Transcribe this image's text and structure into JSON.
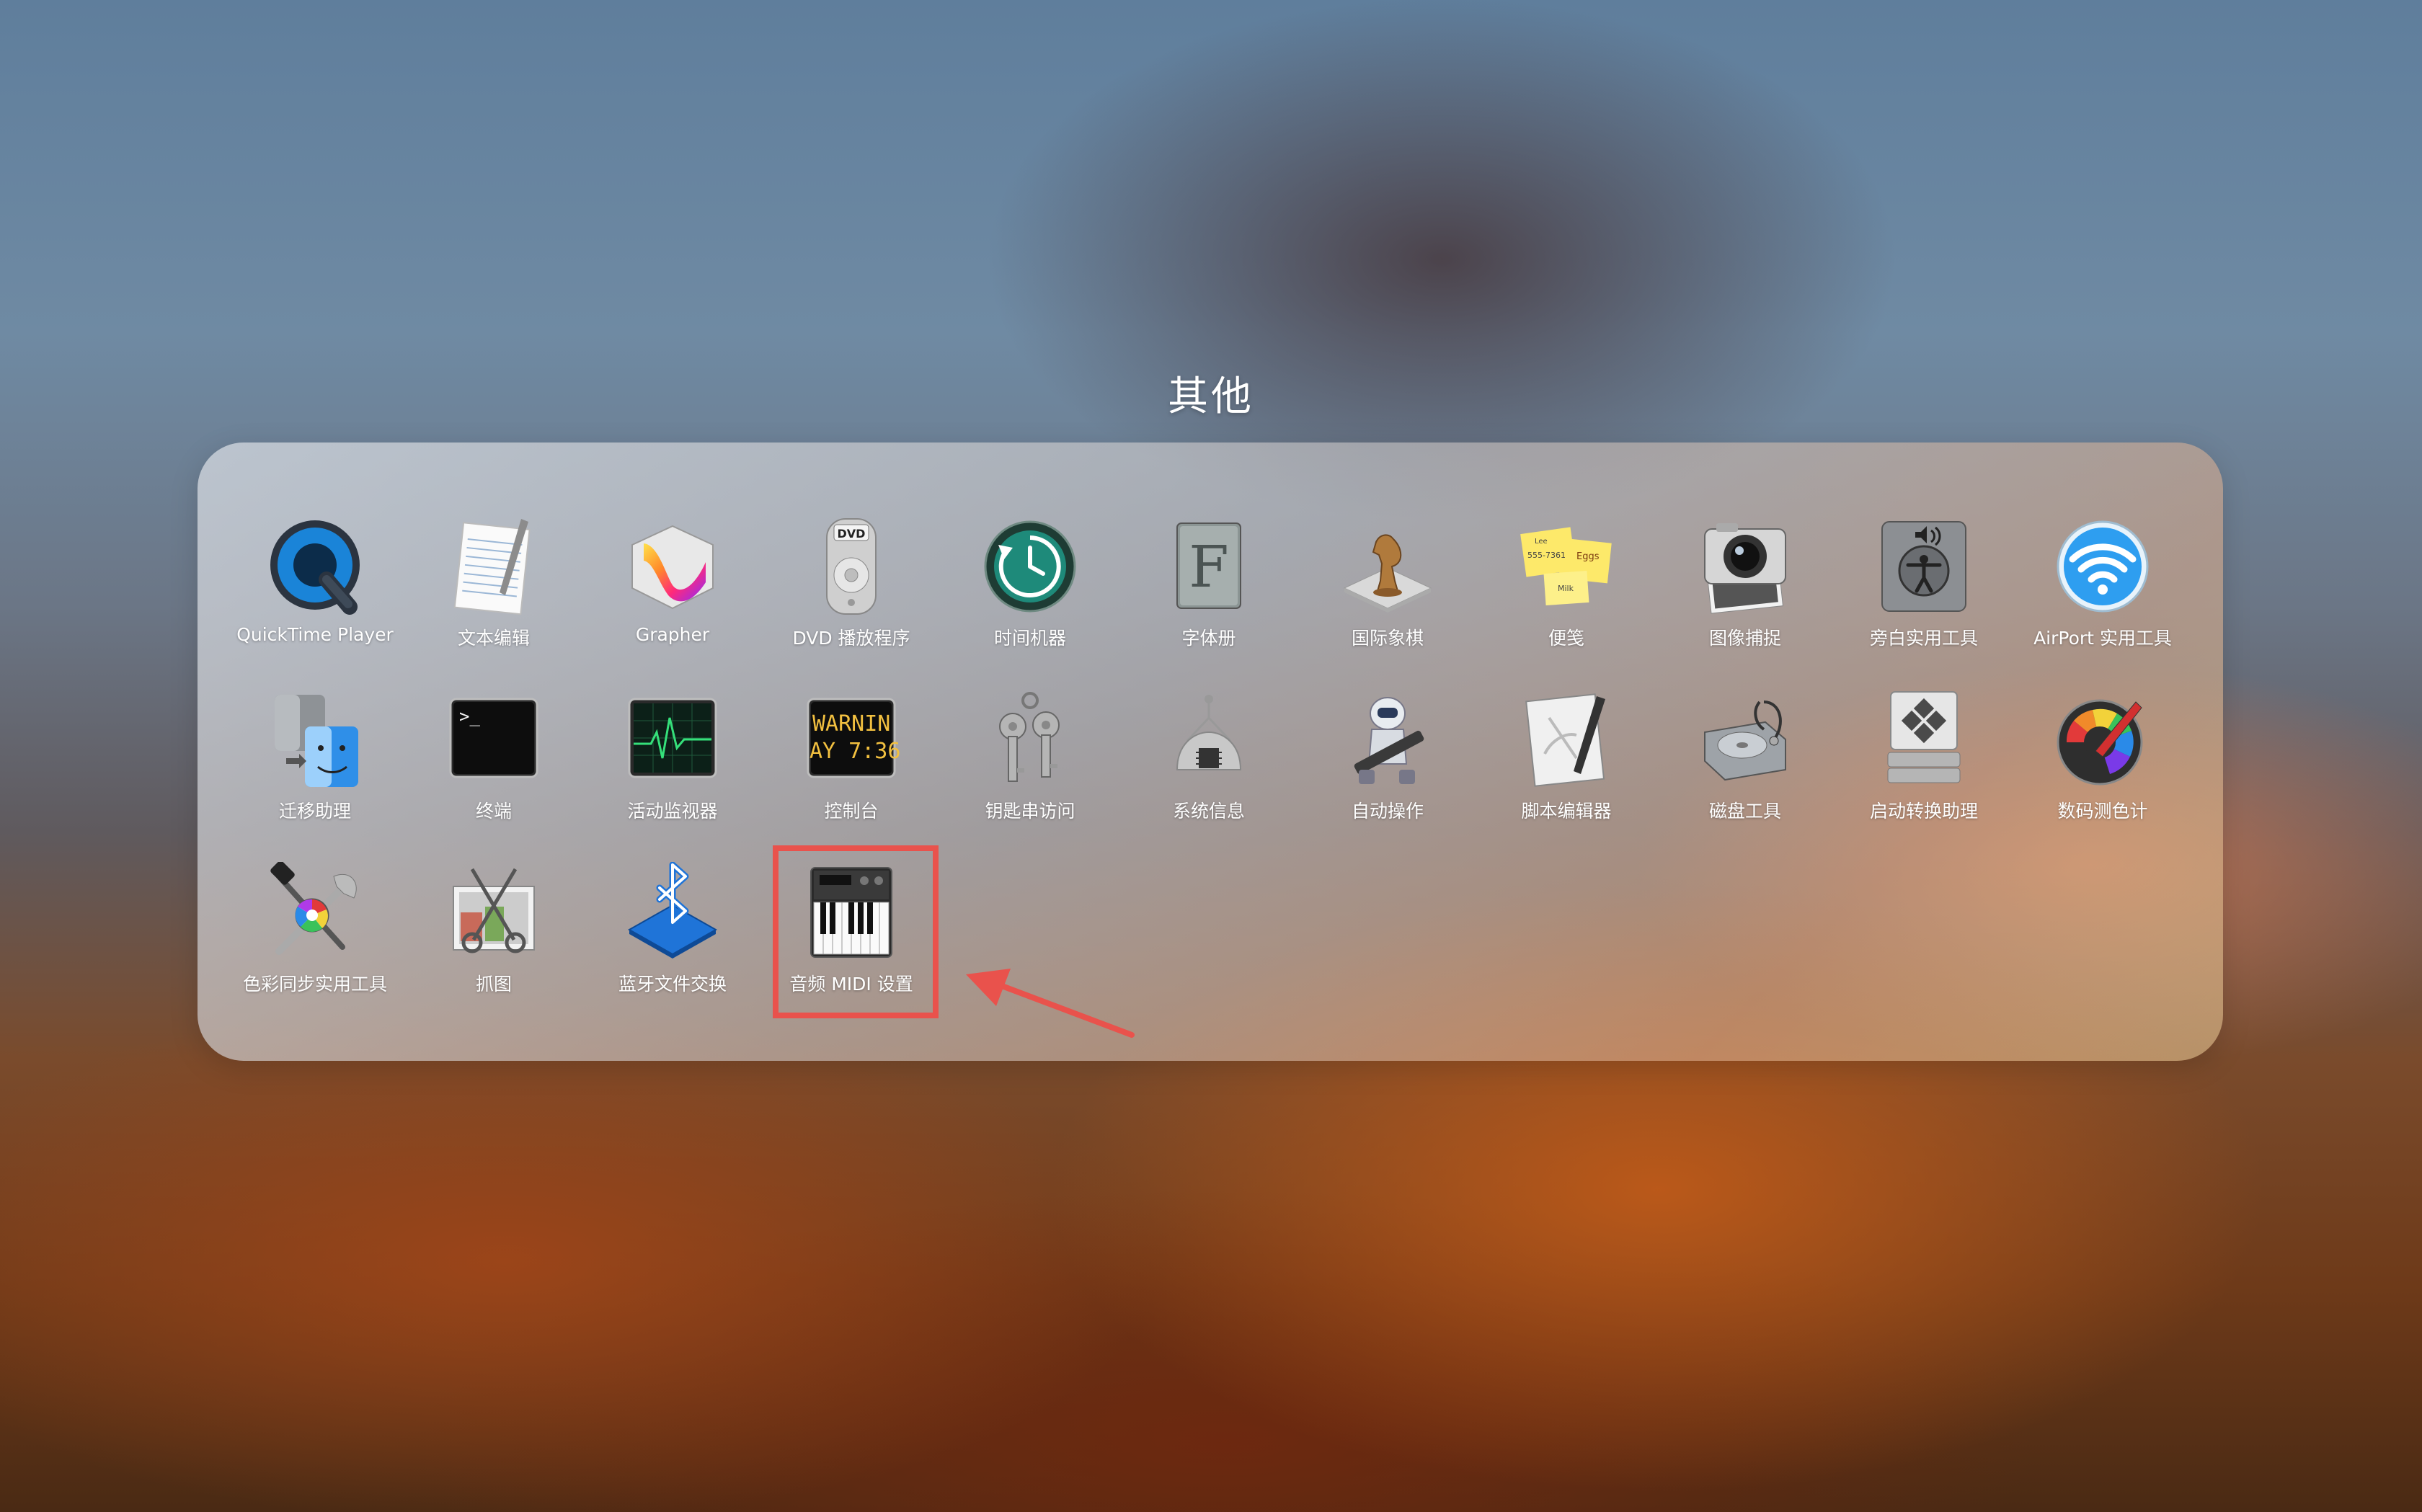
{
  "folder": {
    "title": "其他"
  },
  "apps": [
    {
      "label": "QuickTime Player",
      "icon": "quicktime-icon"
    },
    {
      "label": "文本编辑",
      "icon": "textedit-icon"
    },
    {
      "label": "Grapher",
      "icon": "grapher-icon"
    },
    {
      "label": "DVD 播放程序",
      "icon": "dvd-player-icon"
    },
    {
      "label": "时间机器",
      "icon": "time-machine-icon"
    },
    {
      "label": "字体册",
      "icon": "font-book-icon"
    },
    {
      "label": "国际象棋",
      "icon": "chess-icon"
    },
    {
      "label": "便笺",
      "icon": "stickies-icon"
    },
    {
      "label": "图像捕捉",
      "icon": "image-capture-icon"
    },
    {
      "label": "旁白实用工具",
      "icon": "voiceover-utility-icon"
    },
    {
      "label": "AirPort 实用工具",
      "icon": "airport-utility-icon"
    },
    {
      "label": "迁移助理",
      "icon": "migration-assistant-icon"
    },
    {
      "label": "终端",
      "icon": "terminal-icon"
    },
    {
      "label": "活动监视器",
      "icon": "activity-monitor-icon"
    },
    {
      "label": "控制台",
      "icon": "console-icon"
    },
    {
      "label": "钥匙串访问",
      "icon": "keychain-access-icon"
    },
    {
      "label": "系统信息",
      "icon": "system-information-icon"
    },
    {
      "label": "自动操作",
      "icon": "automator-icon"
    },
    {
      "label": "脚本编辑器",
      "icon": "script-editor-icon"
    },
    {
      "label": "磁盘工具",
      "icon": "disk-utility-icon"
    },
    {
      "label": "启动转换助理",
      "icon": "boot-camp-icon"
    },
    {
      "label": "数码测色计",
      "icon": "digital-color-meter-icon"
    },
    {
      "label": "色彩同步实用工具",
      "icon": "colorsync-utility-icon"
    },
    {
      "label": "抓图",
      "icon": "grab-icon"
    },
    {
      "label": "蓝牙文件交换",
      "icon": "bluetooth-file-exchange-icon"
    },
    {
      "label": "音频 MIDI 设置",
      "icon": "audio-midi-setup-icon"
    }
  ],
  "icon_text": {
    "dvd": "DVD",
    "font": "F",
    "terminal": ">_",
    "console_line1": "WARNIN",
    "console_line2": "AY 7:36",
    "stickies_1": "Lee",
    "stickies_2": "555-7361",
    "stickies_3": "Eggs",
    "stickies_4": "Milk"
  },
  "annotation": {
    "color": "#e9524c"
  }
}
